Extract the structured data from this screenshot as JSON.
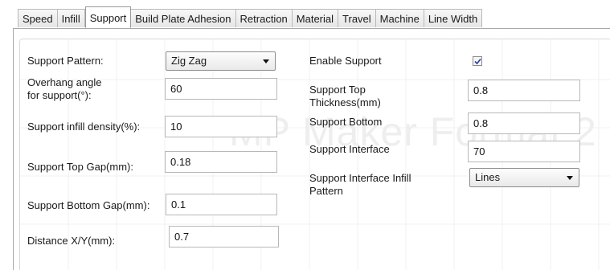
{
  "tabs": [
    "Speed",
    "Infill",
    "Support",
    "Build Plate Adhesion",
    "Retraction",
    "Material",
    "Travel",
    "Machine",
    "Line Width"
  ],
  "active_tab": "Support",
  "watermark": "MP Maker Format 2",
  "left": {
    "support_pattern": {
      "label": "Support Pattern:",
      "value": "Zig Zag"
    },
    "overhang_angle": {
      "label_line1": "Overhang angle",
      "label_line2": "for support(°):",
      "value": "60"
    },
    "support_infill_density": {
      "label": "Support infill density(%):",
      "value": "10"
    },
    "support_top_gap": {
      "label": "Support Top Gap(mm):",
      "value": "0.18"
    },
    "support_bottom_gap": {
      "label": "Support Bottom Gap(mm):",
      "value": "0.1"
    },
    "distance_xy": {
      "label": "Distance X/Y(mm):",
      "value": "0.7"
    }
  },
  "right": {
    "enable_support": {
      "label": "Enable Support",
      "checked": true
    },
    "support_top_thickness": {
      "label_line1": "Support Top",
      "label_line2": "Thickness(mm)",
      "value": "0.8"
    },
    "support_bottom": {
      "label": "Support Bottom",
      "value": "0.8"
    },
    "support_interface": {
      "label": "Support Interface",
      "value": "70"
    },
    "support_interface_infill_pattern": {
      "label_line1": "Support Interface Infill",
      "label_line2": "Pattern",
      "value": "Lines"
    }
  }
}
